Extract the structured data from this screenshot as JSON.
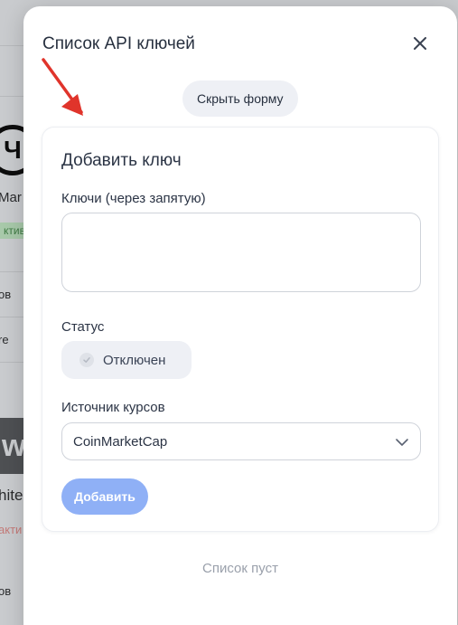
{
  "background": {
    "logo_text": "Ч",
    "partial_texts": [
      "Mar",
      "ктив",
      "ов",
      "re",
      "w",
      "hite",
      "акти",
      "ов"
    ]
  },
  "modal": {
    "title": "Список API ключей",
    "close_icon": "close-icon",
    "toggle_form_label": "Скрыть форму",
    "form": {
      "title": "Добавить ключ",
      "keys_label": "Ключи (через запятую)",
      "keys_value": "",
      "keys_placeholder": "",
      "status_label": "Статус",
      "status_value": "Отключен",
      "source_label": "Источник курсов",
      "source_value": "CoinMarketCap",
      "add_button": "Добавить"
    },
    "empty_list_text": "Список пуст"
  },
  "colors": {
    "accent_disabled": "#8fb0f6",
    "annotation_arrow": "#e0342b"
  }
}
